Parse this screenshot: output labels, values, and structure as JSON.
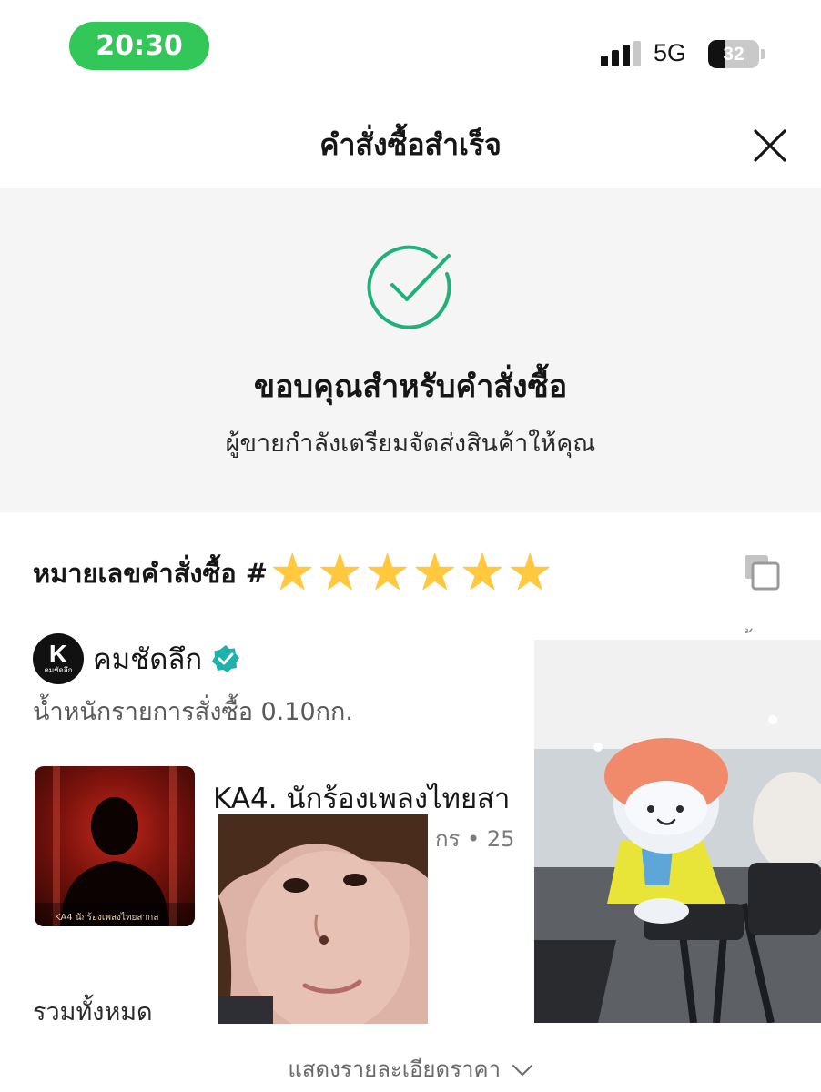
{
  "status_bar": {
    "time": "20:30",
    "network": "5G",
    "battery": "32",
    "battery_level": 0.32
  },
  "header": {
    "title": "คำสั่งซื้อสำเร็จ",
    "close_icon": "close-icon"
  },
  "success": {
    "icon": "check-circle-icon",
    "title": "ขอบคุณสำหรับคำสั่งซื้อ",
    "subtitle": "ผู้ขายกำลังเตรียมจัดส่งสินค้าให้คุณ"
  },
  "order": {
    "number_label": "หมายเลขคำสั่งซื้อ #",
    "star_count": 6,
    "copy_icon": "copy-icon",
    "shop": {
      "logo_letter": "K",
      "logo_caption": "คมชัดลึก",
      "name": "คมชัดลึก",
      "verified_icon": "verified-badge-icon"
    },
    "right_edge_mark": "้",
    "weight": "น้ำหนักรายการสั่งซื้อ 0.10กก.",
    "product": {
      "thumb_caption": "KA4 นักร้องเพลงไทยสากล",
      "title": "KA4. นักร้องเพลงไทยสา",
      "meta": "กร • 25"
    },
    "total_label": "รวมทั้งหมด",
    "price_details_label": "แสดงรายละเอียดราคา"
  },
  "colors": {
    "status_green": "#33c759",
    "success_green": "#22b07a",
    "verified_teal": "#20b2aa",
    "panel_bg": "#f5f5f5"
  }
}
